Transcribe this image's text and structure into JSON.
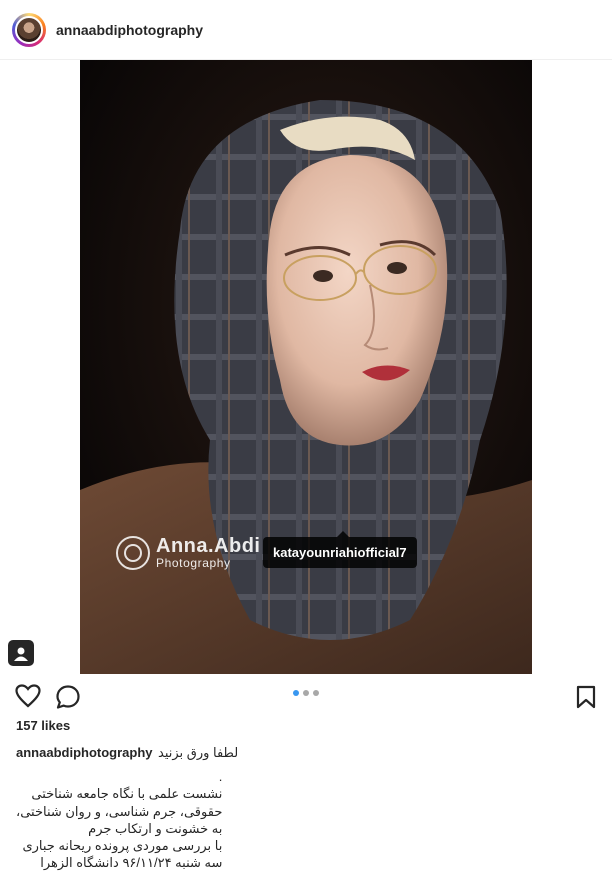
{
  "post": {
    "username": "annaabdiphotography",
    "photo_tag": "katayounriahiofficial7",
    "watermark": {
      "name": "Anna.Abdi",
      "sub": "Photography"
    },
    "carousel": {
      "count": 3,
      "active_index": 0
    },
    "likes": "157 likes",
    "caption": {
      "author": "annaabdiphotography",
      "first_line": "لطفا ورق بزنید",
      "lines": [
        ".",
        "نشست علمی با نگاه جامعه شناختی",
        "حقوقی، جرم شناسی، و روان شناختی،",
        "به خشونت و ارتکاب جرم",
        "با بررسی موردی پرونده ریحانه جباری",
        "سه شنبه ۹۶/۱۱/۲۴ دانشگاه الزهرا"
      ]
    }
  },
  "icons": {
    "like": "heart-icon",
    "comment": "comment-icon",
    "save": "bookmark-icon",
    "tagged": "user-tag-icon"
  },
  "colors": {
    "accent": "#3897f0",
    "text": "#262626",
    "divider": "#efefef"
  }
}
